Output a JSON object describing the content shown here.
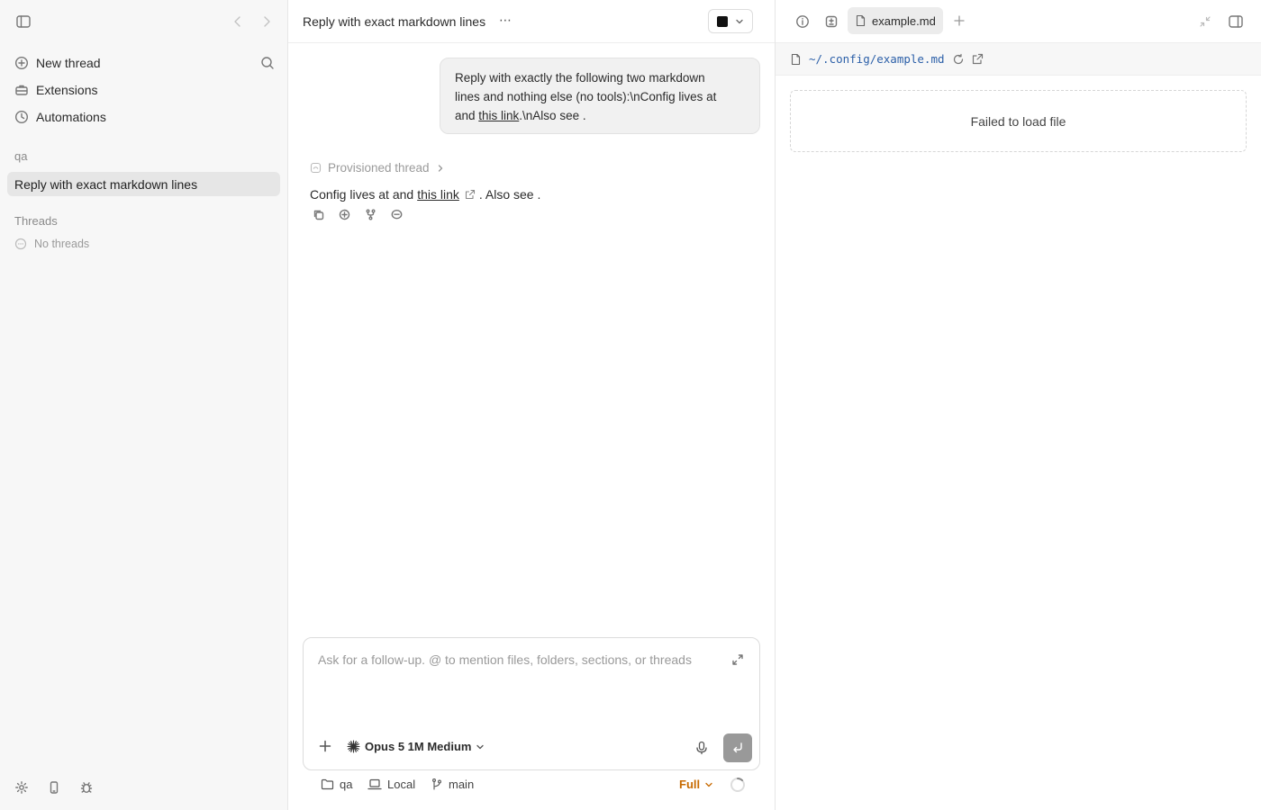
{
  "sidebar": {
    "nav": {
      "new_thread": "New thread",
      "extensions": "Extensions",
      "automations": "Automations"
    },
    "project": "qa",
    "active_thread": "Reply with exact markdown lines",
    "threads_header": "Threads",
    "no_threads": "No threads"
  },
  "thread": {
    "title": "Reply with exact markdown lines",
    "more": "⋯",
    "user_message": {
      "line1": "Reply with exactly the following two markdown",
      "line2": "lines and nothing else (no tools):\\nConfig lives at",
      "line3_pre": "and ",
      "line3_link": "this link",
      "line3_post": ".\\nAlso see ."
    },
    "provisioned_label": "Provisioned thread",
    "reply": {
      "pre": "Config lives at and",
      "link": "this link",
      "post": ". Also see ."
    }
  },
  "composer": {
    "placeholder": "Ask for a follow-up. @ to mention files, folders, sections, or threads",
    "model": "Opus 5 1M Medium"
  },
  "footer": {
    "folder": "qa",
    "env": "Local",
    "branch": "main",
    "mode": "Full"
  },
  "right_panel": {
    "tab_label": "example.md",
    "file_path": "~/.config/example.md",
    "error": "Failed to load file"
  },
  "colors": {
    "accent_mode": "#c76a00",
    "path_link": "#2b5fa8",
    "active_row": "#e6e6e6"
  }
}
